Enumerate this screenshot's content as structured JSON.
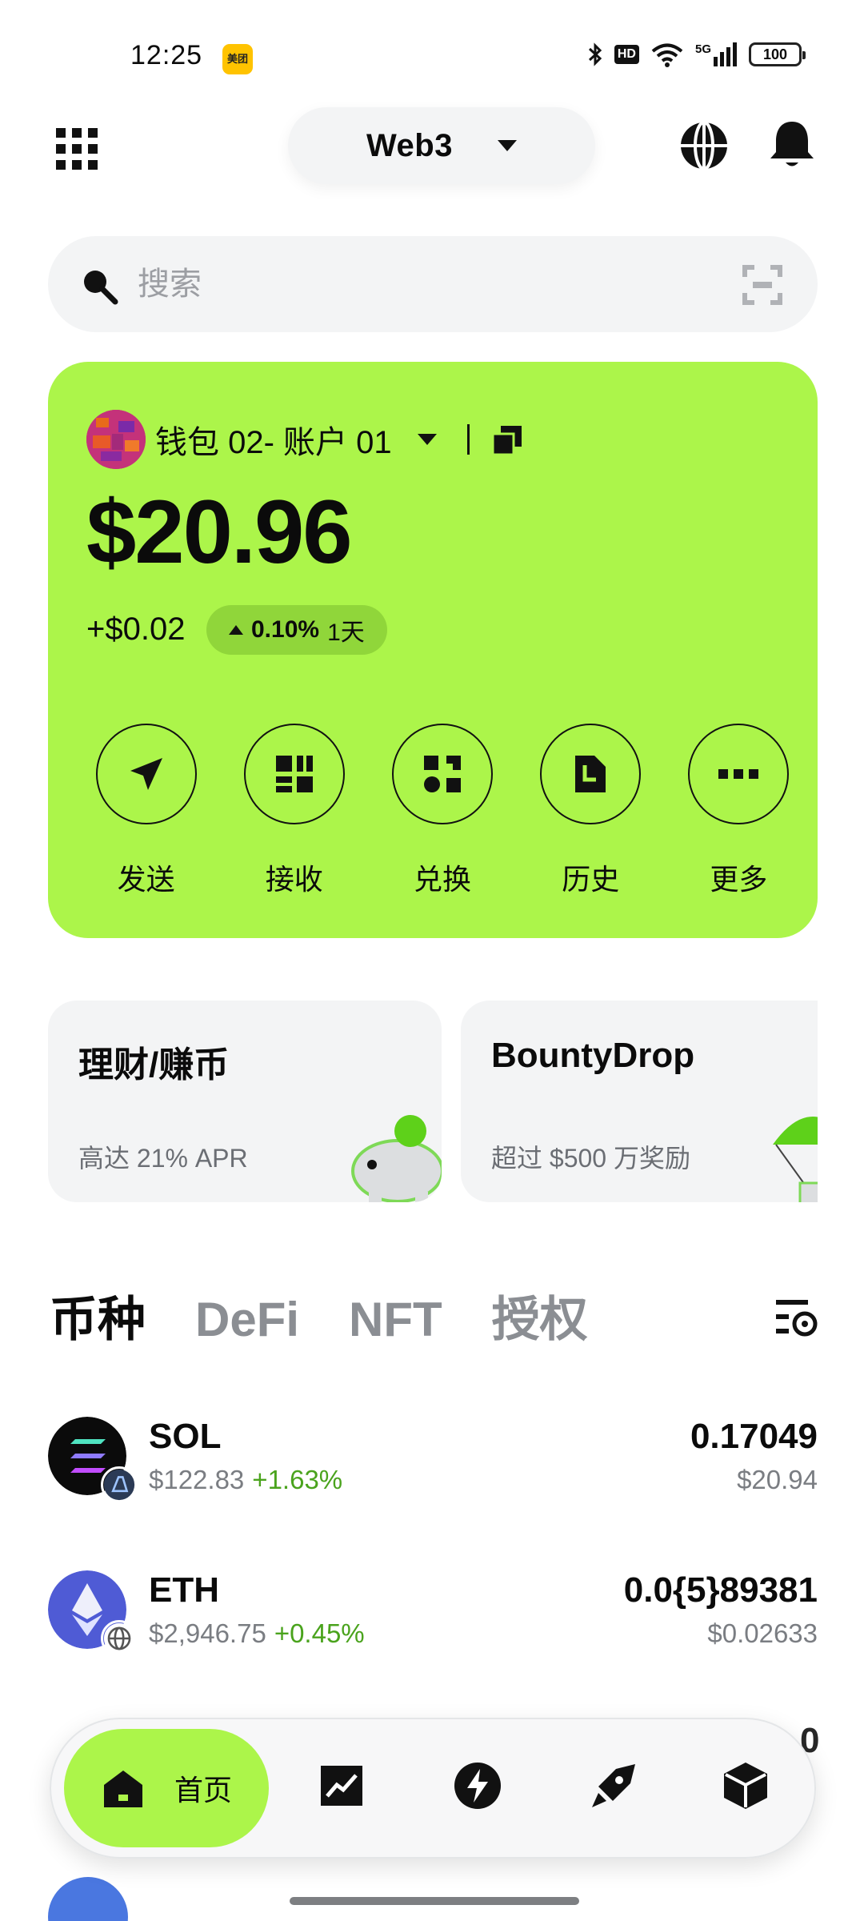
{
  "status_bar": {
    "time": "12:25",
    "meituan_badge": "美团",
    "hd_label": "HD",
    "network_label": "5G",
    "battery_level": "100"
  },
  "header": {
    "mode_label": "Web3",
    "icons": [
      "apps-grid-icon",
      "globe-icon",
      "bell-icon"
    ]
  },
  "search": {
    "placeholder": "搜索",
    "icons": [
      "search-icon",
      "scan-icon"
    ]
  },
  "wallet": {
    "account_name": "钱包 02- 账户 01",
    "balance": "$20.96",
    "change_amount": "+$0.02",
    "change_percent": "0.10%",
    "change_period": "1天",
    "card_color": "#acf54a",
    "actions": [
      {
        "label": "发送",
        "icon": "send-icon"
      },
      {
        "label": "接收",
        "icon": "receive-qr-icon"
      },
      {
        "label": "兑换",
        "icon": "swap-icon"
      },
      {
        "label": "历史",
        "icon": "history-document-icon"
      },
      {
        "label": "更多",
        "icon": "more-dots-icon"
      }
    ]
  },
  "promos": [
    {
      "title": "理财/赚币",
      "subtitle": "高达 21% APR",
      "icon": "piggy-bank-icon"
    },
    {
      "title": "BountyDrop",
      "subtitle": "超过 $500 万奖励",
      "icon": "parachute-icon"
    }
  ],
  "tabs": [
    {
      "label": "币种",
      "active": true
    },
    {
      "label": "DeFi",
      "active": false
    },
    {
      "label": "NFT",
      "active": false
    },
    {
      "label": "授权",
      "active": false
    }
  ],
  "tokens": [
    {
      "symbol": "SOL",
      "price": "$122.83",
      "change": "+1.63%",
      "amount": "0.17049",
      "value": "$20.94"
    },
    {
      "symbol": "ETH",
      "price": "$2,946.75",
      "change": "+0.45%",
      "amount": "0.0{5}89381",
      "value": "$0.02633"
    }
  ],
  "peek": {
    "partial_amount_char": "0"
  },
  "bottom_nav": {
    "home_label": "首页",
    "items": [
      "home-icon",
      "market-chart-icon",
      "discover-bolt-icon",
      "earn-rocket-icon",
      "web3-cube-icon"
    ]
  },
  "colors": {
    "accent": "#acf54a",
    "positive": "#4aa31d",
    "muted": "#7a7d82"
  }
}
